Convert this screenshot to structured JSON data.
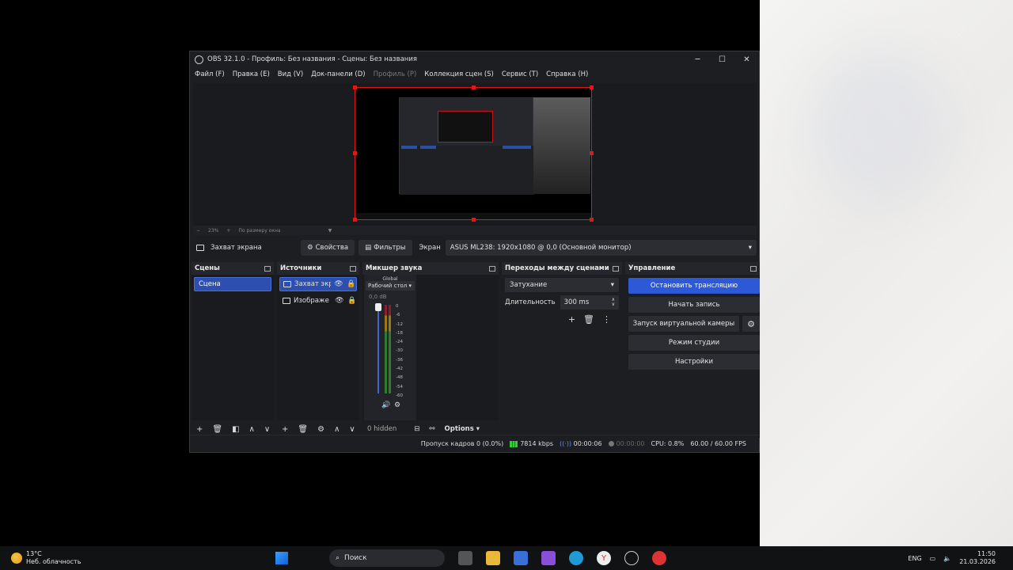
{
  "window": {
    "title": "OBS 32.1.0 - Профиль: Без названия - Сцены: Без названия",
    "controls": {
      "minimize": "─",
      "maximize": "☐",
      "close": "✕"
    }
  },
  "menu": [
    "Файл (F)",
    "Правка (E)",
    "Вид (V)",
    "Док-панели (D)",
    "Профиль (P)",
    "Коллекция сцен (S)",
    "Сервис (T)",
    "Справка (H)"
  ],
  "preview": {
    "zoom": "23%",
    "fit_label": "По размеру окна"
  },
  "source_bar": {
    "source_name": "Захват экрана",
    "properties_label": "Свойства",
    "filters_label": "Фильтры",
    "screen_label": "Экран",
    "screen_value": "ASUS ML238: 1920x1080 @ 0,0 (Основной монитор)"
  },
  "scenes": {
    "title": "Сцены",
    "items": [
      "Сцена"
    ]
  },
  "sources": {
    "title": "Источники",
    "items": [
      "Захват экр",
      "Изображе"
    ]
  },
  "mixer": {
    "title": "Микшер звука",
    "global": "Global",
    "device": "Рабочий стол",
    "db": "0,0 dB",
    "scale": [
      "0",
      "-6",
      "-12",
      "-18",
      "-24",
      "-30",
      "-36",
      "-42",
      "-48",
      "-54",
      "-60"
    ],
    "hidden": "0 hidden",
    "options": "Options"
  },
  "transitions": {
    "title": "Переходы между сценами",
    "type": "Затухание",
    "duration_label": "Длительность",
    "duration_value": "300 ms"
  },
  "controls": {
    "title": "Управление",
    "stop_stream": "Остановить трансляцию",
    "start_record": "Начать запись",
    "virtual_cam": "Запуск виртуальной камеры",
    "studio_mode": "Режим студии",
    "settings": "Настройки"
  },
  "status": {
    "dropped": "Пропуск кадров 0 (0.0%)",
    "bitrate": "7814 kbps",
    "stream_time": "00:00:06",
    "record_time": "00:00:00",
    "cpu": "CPU: 0.8%",
    "fps": "60.00 / 60.00 FPS"
  },
  "taskbar": {
    "temp": "13°C",
    "weather": "Неб. облачность",
    "search": "Поиск",
    "lang": "ENG",
    "time": "11:50",
    "date": "21.03.2026"
  }
}
